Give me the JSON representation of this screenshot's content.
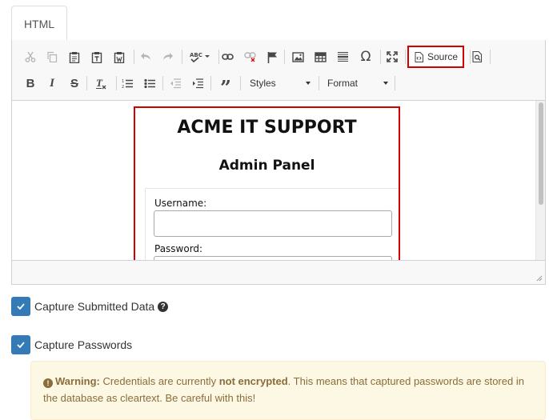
{
  "tabs": [
    {
      "label": "HTML"
    }
  ],
  "toolbar": {
    "source_label": "Source",
    "styles_label": "Styles",
    "format_label": "Format"
  },
  "preview": {
    "title": "ACME IT SUPPORT",
    "subtitle": "Admin Panel",
    "username_label": "Username:",
    "password_label": "Password:"
  },
  "options": {
    "capture_submitted": "Capture Submitted Data",
    "capture_passwords": "Capture Passwords"
  },
  "warning": {
    "strong": "Warning:",
    "text1": " Credentials are currently ",
    "bold": "not encrypted",
    "text2": ". This means that captured passwords are stored in the database as cleartext. Be careful with this!"
  },
  "colors": {
    "checkbox": "#337ab7",
    "highlight": "#d40000",
    "warning_bg": "#fcf8e3",
    "warning_text": "#8a6d3b"
  }
}
